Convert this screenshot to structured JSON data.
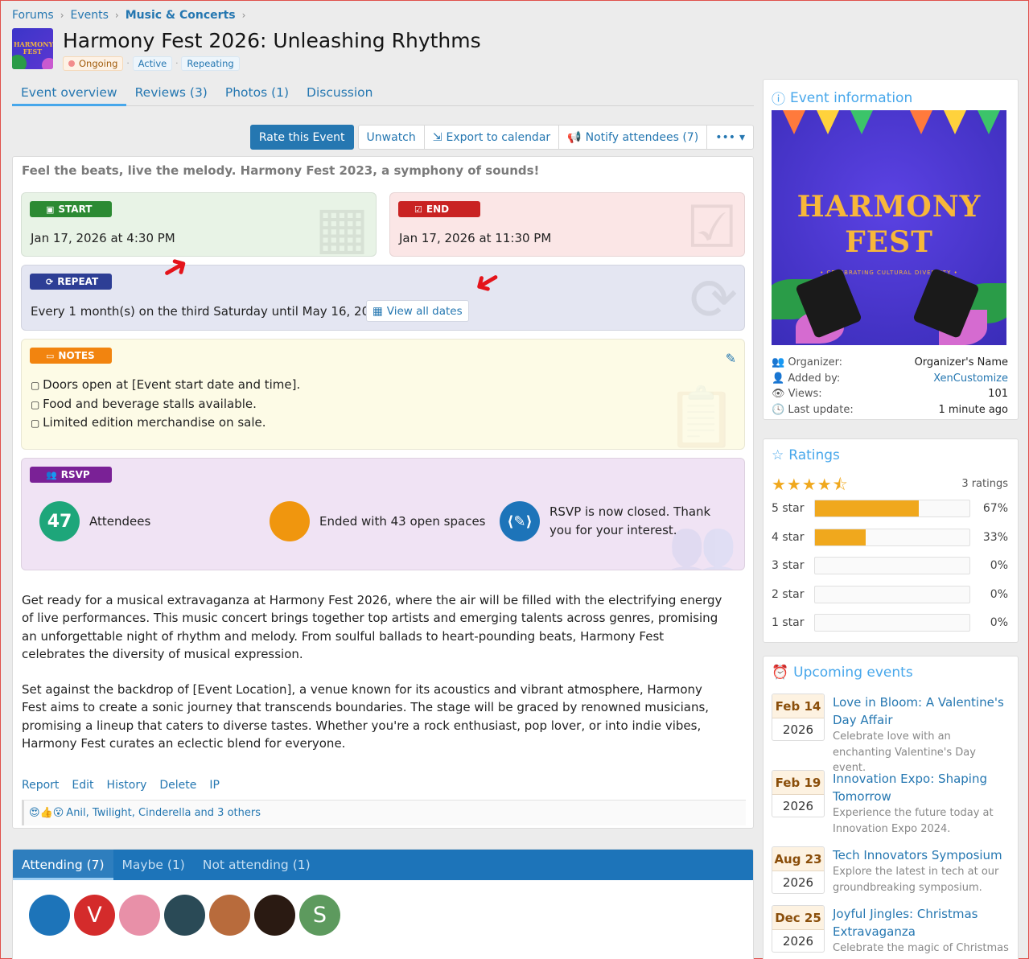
{
  "breadcrumb": [
    "Forums",
    "Events",
    "Music & Concerts"
  ],
  "thumb_text": "HARMONY FEST",
  "title": "Harmony Fest 2026: Unleashing Rhythms",
  "labels": {
    "ongoing": "Ongoing",
    "active": "Active",
    "repeating": "Repeating"
  },
  "tabs": [
    "Event overview",
    "Reviews (3)",
    "Photos (1)",
    "Discussion"
  ],
  "actions": {
    "rate": "Rate this Event",
    "unwatch": "Unwatch",
    "export": "Export to calendar",
    "notify": "Notify attendees (7)",
    "more": "•••"
  },
  "tagline": "Feel the beats, live the melody. Harmony Fest 2023, a symphony of sounds!",
  "start": {
    "badge": "START",
    "value": "Jan 17, 2026 at 4:30 PM"
  },
  "end": {
    "badge": "END",
    "value": "Jan 17, 2026 at 11:30 PM"
  },
  "repeat": {
    "badge": "REPEAT",
    "value": "Every 1 month(s) on the third Saturday until May 16, 2026",
    "view_dates": "View all dates"
  },
  "notes": {
    "badge": "NOTES",
    "items": [
      "Doors open at [Event start date and time].",
      "Food and beverage stalls available.",
      "Limited edition merchandise on sale."
    ]
  },
  "rsvp": {
    "badge": "RSVP",
    "attendees_count": "47",
    "attendees_label": "Attendees",
    "spaces": "Ended with 43 open spaces",
    "closed": "RSVP is now closed. Thank you for your interest."
  },
  "body": {
    "p1": "Get ready for a musical extravaganza at Harmony Fest 2026, where the air will be filled with the electrifying energy of live performances. This music concert brings together top artists and emerging talents across genres, promising an unforgettable night of rhythm and melody. From soulful ballads to heart-pounding beats, Harmony Fest celebrates the diversity of musical expression.",
    "p2": "Set against the backdrop of [Event Location], a venue known for its acoustics and vibrant atmosphere, Harmony Fest aims to create a sonic journey that transcends boundaries. The stage will be graced by renowned musicians, promising a lineup that caters to diverse tastes. Whether you're a rock enthusiast, pop lover, or into indie vibes, Harmony Fest curates an eclectic blend for everyone."
  },
  "post_actions": [
    "Report",
    "Edit",
    "History",
    "Delete",
    "IP"
  ],
  "reactions": {
    "emoji": "😍👍😮",
    "text": "Anil, Twilight, Cinderella and 3 others"
  },
  "attending_tabs": [
    "Attending (7)",
    "Maybe (1)",
    "Not attending (1)"
  ],
  "avatars": [
    {
      "letter": "",
      "color": "#1d74b9"
    },
    {
      "letter": "V",
      "color": "#d42b2b"
    },
    {
      "letter": "",
      "color": "#e890a8"
    },
    {
      "letter": "",
      "color": "#2a4a56"
    },
    {
      "letter": "",
      "color": "#b86b3c"
    },
    {
      "letter": "",
      "color": "#2a1a12"
    },
    {
      "letter": "S",
      "color": "#5d9a5e"
    }
  ],
  "event_info": {
    "heading": "Event information",
    "poster_title": "HARMONY FEST",
    "poster_sub": "• CELEBRATING CULTURAL DIVERSITY •",
    "organizer_label": "Organizer:",
    "organizer": "Organizer's Name",
    "added_label": "Added by:",
    "added_by": "XenCustomize",
    "views_label": "Views:",
    "views": "101",
    "update_label": "Last update:",
    "last_update": "1 minute ago"
  },
  "ratings": {
    "heading": "Ratings",
    "stars": "★★★★⯪",
    "count": "3 ratings",
    "rows": [
      {
        "label": "5 star",
        "pct": "67%",
        "value": 67
      },
      {
        "label": "4 star",
        "pct": "33%",
        "value": 33
      },
      {
        "label": "3 star",
        "pct": "0%",
        "value": 0
      },
      {
        "label": "2 star",
        "pct": "0%",
        "value": 0
      },
      {
        "label": "1 star",
        "pct": "0%",
        "value": 0
      }
    ]
  },
  "upcoming": {
    "heading": "Upcoming events",
    "items": [
      {
        "md": "Feb 14",
        "yr": "2026",
        "title": "Love in Bloom: A Valentine's Day Affair",
        "desc": "Celebrate love with an enchanting Valentine's Day event."
      },
      {
        "md": "Feb 19",
        "yr": "2026",
        "title": "Innovation Expo: Shaping Tomorrow",
        "desc": "Experience the future today at Innovation Expo 2024."
      },
      {
        "md": "Aug 23",
        "yr": "2026",
        "title": "Tech Innovators Symposium",
        "desc": "Explore the latest in tech at our groundbreaking symposium."
      },
      {
        "md": "Dec 25",
        "yr": "2026",
        "title": "Joyful Jingles: Christmas Extravaganza",
        "desc": "Celebrate the magic of Christmas"
      }
    ]
  },
  "colors": {
    "accent": "#2577b1",
    "start": "#2c8a33",
    "end": "#c92323",
    "repeat": "#2d3e95",
    "notes": "#f2840f",
    "rsvp": "#7a2196",
    "star": "#f0a81d"
  }
}
